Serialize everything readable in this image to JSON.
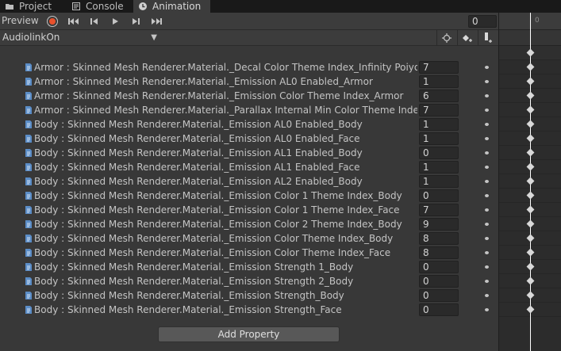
{
  "tabs": [
    {
      "label": "Project",
      "icon": "folder-icon"
    },
    {
      "label": "Console",
      "icon": "console-icon"
    },
    {
      "label": "Animation",
      "icon": "animation-icon"
    }
  ],
  "toolbar": {
    "preview_label": "Preview",
    "frame_value": "0"
  },
  "clip": {
    "selected": "AudiolinkOn"
  },
  "timeline": {
    "tick_label": "0"
  },
  "properties": [
    {
      "name": "Armor : Skinned Mesh Renderer.Material._Decal Color Theme Index_Infinity Poiyomi",
      "value": "7"
    },
    {
      "name": "Armor : Skinned Mesh Renderer.Material._Emission AL0 Enabled_Armor",
      "value": "1"
    },
    {
      "name": "Armor : Skinned Mesh Renderer.Material._Emission Color Theme Index_Armor",
      "value": "6"
    },
    {
      "name": "Armor : Skinned Mesh Renderer.Material._Parallax Internal Min Color Theme Index_Infin",
      "value": "7"
    },
    {
      "name": "Body : Skinned Mesh Renderer.Material._Emission AL0 Enabled_Body",
      "value": "1"
    },
    {
      "name": "Body : Skinned Mesh Renderer.Material._Emission AL0 Enabled_Face",
      "value": "1"
    },
    {
      "name": "Body : Skinned Mesh Renderer.Material._Emission AL1 Enabled_Body",
      "value": "0"
    },
    {
      "name": "Body : Skinned Mesh Renderer.Material._Emission AL1 Enabled_Face",
      "value": "1"
    },
    {
      "name": "Body : Skinned Mesh Renderer.Material._Emission AL2 Enabled_Body",
      "value": "1"
    },
    {
      "name": "Body : Skinned Mesh Renderer.Material._Emission Color 1 Theme Index_Body",
      "value": "0"
    },
    {
      "name": "Body : Skinned Mesh Renderer.Material._Emission Color 1 Theme Index_Face",
      "value": "7"
    },
    {
      "name": "Body : Skinned Mesh Renderer.Material._Emission Color 2 Theme Index_Body",
      "value": "9"
    },
    {
      "name": "Body : Skinned Mesh Renderer.Material._Emission Color Theme Index_Body",
      "value": "8"
    },
    {
      "name": "Body : Skinned Mesh Renderer.Material._Emission Color Theme Index_Face",
      "value": "8"
    },
    {
      "name": "Body : Skinned Mesh Renderer.Material._Emission Strength 1_Body",
      "value": "0"
    },
    {
      "name": "Body : Skinned Mesh Renderer.Material._Emission Strength 2_Body",
      "value": "0"
    },
    {
      "name": "Body : Skinned Mesh Renderer.Material._Emission Strength_Body",
      "value": "0"
    },
    {
      "name": "Body : Skinned Mesh Renderer.Material._Emission Strength_Face",
      "value": "0"
    }
  ],
  "add_property_label": "Add Property",
  "colors": {
    "record": "#e9512c",
    "panel": "#383838",
    "field": "#2a2a2a"
  }
}
